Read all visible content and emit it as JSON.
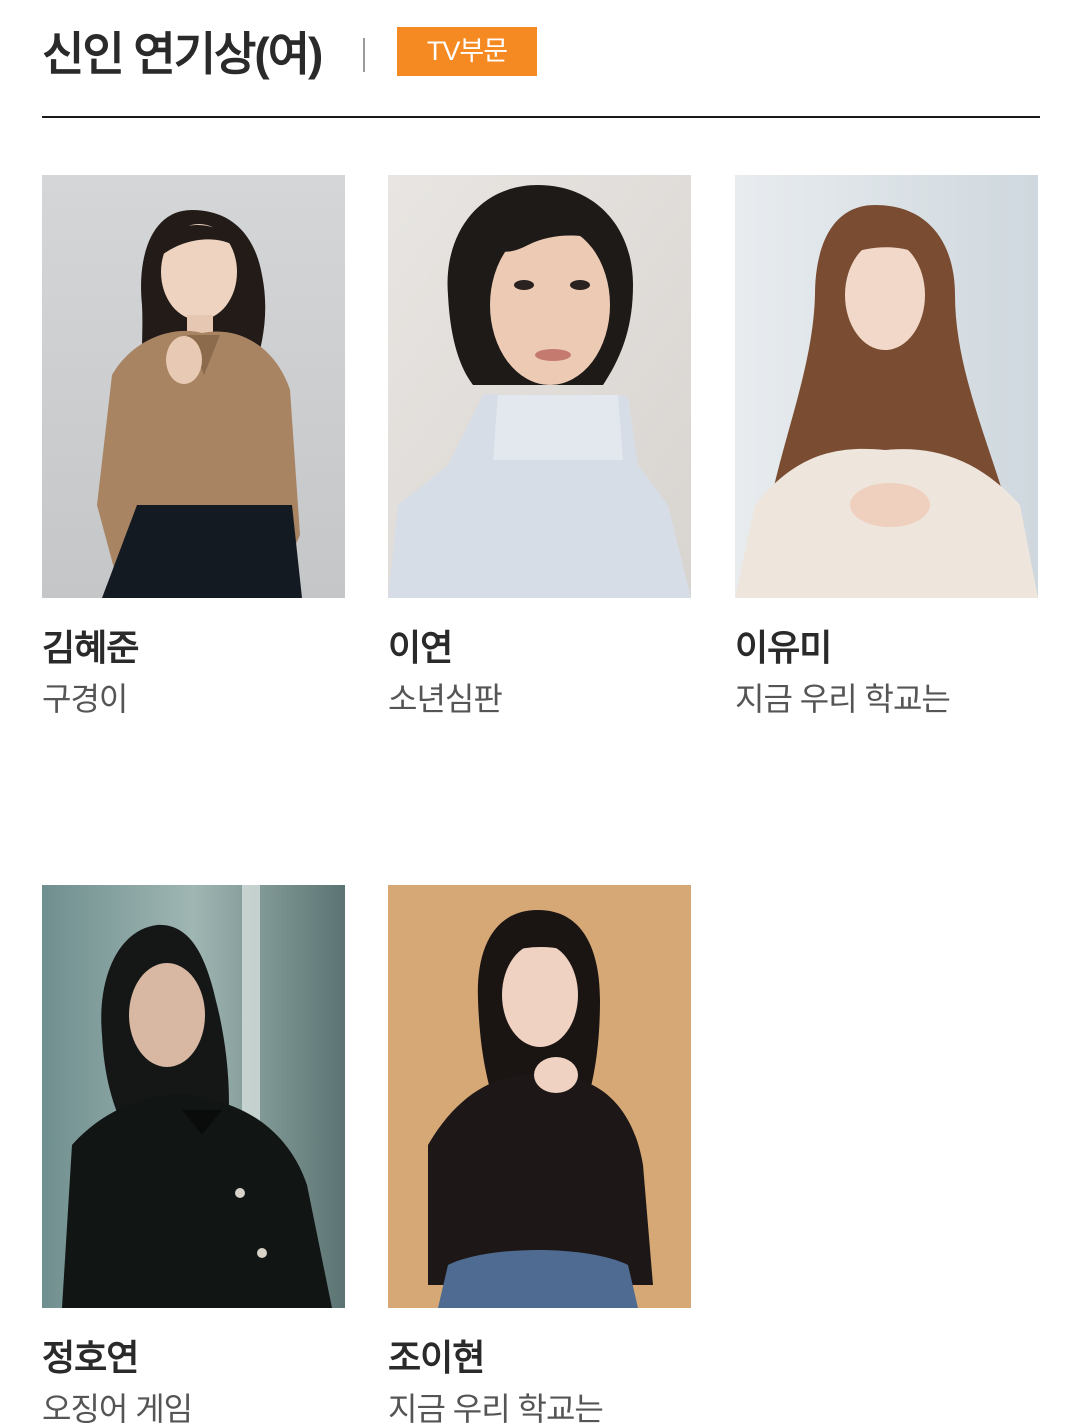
{
  "header": {
    "title": "신인 연기상(여)",
    "badge": "TV부문"
  },
  "nominees": [
    {
      "name": "김혜준",
      "work": "구경이"
    },
    {
      "name": "이연",
      "work": "소년심판"
    },
    {
      "name": "이유미",
      "work": "지금 우리 학교는"
    },
    {
      "name": "정호연",
      "work": "오징어 게임"
    },
    {
      "name": "조이현",
      "work": "지금 우리 학교는"
    }
  ],
  "colors": {
    "badge": "#f58a22",
    "rule": "#1a1a1a"
  }
}
